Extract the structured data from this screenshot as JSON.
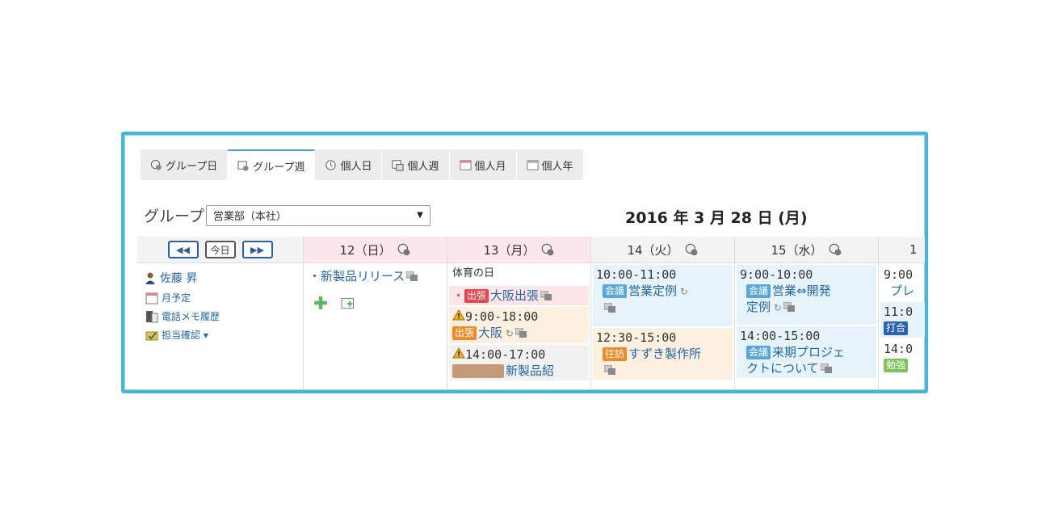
{
  "tabs": [
    {
      "label": "グループ日",
      "icon": "group-day-icon"
    },
    {
      "label": "グループ週",
      "icon": "group-week-icon",
      "active": true
    },
    {
      "label": "個人日",
      "icon": "clock-icon"
    },
    {
      "label": "個人週",
      "icon": "personal-week-icon"
    },
    {
      "label": "個人月",
      "icon": "calendar-month-icon"
    },
    {
      "label": "個人年",
      "icon": "calendar-year-icon"
    }
  ],
  "group": {
    "label": "グループ",
    "selected": "営業部（本社）"
  },
  "date_title": "2016 年 3 月 28 日 (月)",
  "nav": {
    "prev": "◀◀",
    "today": "今日",
    "next": "▶▶"
  },
  "sidebar": {
    "user": "佐藤 昇",
    "links": [
      "月予定",
      "電話メモ履歴",
      "担当確認 ▾"
    ]
  },
  "days": [
    {
      "label": "12（日）"
    },
    {
      "label": "13（月）"
    },
    {
      "label": "14（火）"
    },
    {
      "label": "15（水）"
    },
    {
      "label": "1"
    }
  ],
  "events": {
    "d12": {
      "title": "・新製品リリース"
    },
    "d13": {
      "holiday": "体育の日",
      "e1": {
        "badge": "出張",
        "title": "大阪出張"
      },
      "e2": {
        "time": "9:00-18:00",
        "badge": "出張",
        "title": "大阪"
      },
      "e3": {
        "time": "14:00-17:00",
        "title": "新製品紹"
      }
    },
    "d14": {
      "e1": {
        "time": "10:00-11:00",
        "badge": "会議",
        "title": "営業定例"
      },
      "e2": {
        "time": "12:30-15:00",
        "badge": "往訪",
        "title": "すずき製作所"
      }
    },
    "d15": {
      "e1": {
        "time": "9:00-10:00",
        "badge": "会議",
        "title": "営業⇔開発",
        "title2": "定例"
      },
      "e2": {
        "time": "14:00-15:00",
        "badge": "会議",
        "title": "来期プロジェ",
        "title2": "クトについて"
      }
    },
    "d16": {
      "e1": {
        "time": "9:00",
        "title": "プレ"
      },
      "e2": {
        "time": "11:0",
        "badge": "打合"
      },
      "e3": {
        "time": "14:0",
        "badge": "勉強"
      }
    }
  }
}
